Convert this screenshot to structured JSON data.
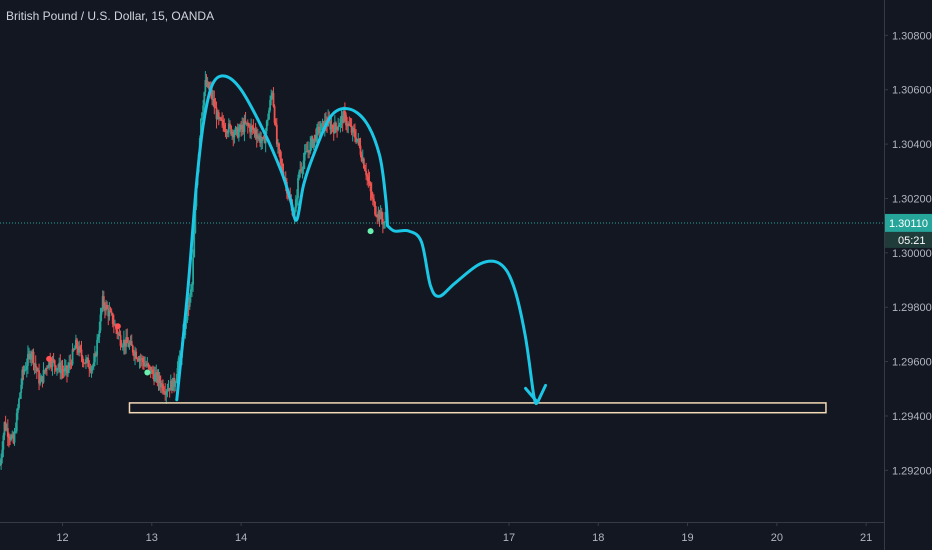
{
  "title": "British Pound / U.S. Dollar, 15, OANDA",
  "colors": {
    "background": "#131722",
    "grid": "#1e2230",
    "axis": "#363a45",
    "text": "#b2b5be",
    "up": "#26a69a",
    "down": "#ef5350",
    "price_line": "#26a69a",
    "drawing": "#1cc6e5",
    "zone": "#f3d9b5"
  },
  "chart_data": {
    "type": "candlestick",
    "symbol": "GBPUSD",
    "timeframe": "15",
    "x_ticks": [
      "12",
      "13",
      "14",
      "17",
      "18",
      "19",
      "20",
      "21"
    ],
    "xlim": [
      11.3,
      21.2
    ],
    "y_ticks": [
      "1.29200",
      "1.29400",
      "1.29600",
      "1.29800",
      "1.30000",
      "1.30200",
      "1.30400",
      "1.30600",
      "1.30800"
    ],
    "ylim": [
      1.2901,
      1.3093
    ],
    "last_price": "1.30110",
    "countdown": "05:21",
    "grid": false,
    "price_outline": [
      [
        11.3,
        1.2922
      ],
      [
        11.35,
        1.2937
      ],
      [
        11.45,
        1.293
      ],
      [
        11.55,
        1.2955
      ],
      [
        11.65,
        1.2964
      ],
      [
        11.75,
        1.2952
      ],
      [
        11.85,
        1.2961
      ],
      [
        11.95,
        1.2958
      ],
      [
        12.05,
        1.2956
      ],
      [
        12.15,
        1.2966
      ],
      [
        12.25,
        1.296
      ],
      [
        12.35,
        1.2958
      ],
      [
        12.45,
        1.2982
      ],
      [
        12.55,
        1.2976
      ],
      [
        12.65,
        1.2968
      ],
      [
        12.75,
        1.2966
      ],
      [
        12.85,
        1.2962
      ],
      [
        12.95,
        1.2958
      ],
      [
        13.05,
        1.2954
      ],
      [
        13.15,
        1.295
      ],
      [
        13.25,
        1.2952
      ],
      [
        13.32,
        1.2962
      ],
      [
        13.38,
        1.2975
      ],
      [
        13.45,
        1.2988
      ],
      [
        13.5,
        1.3025
      ],
      [
        13.55,
        1.305
      ],
      [
        13.6,
        1.3062
      ],
      [
        13.65,
        1.306
      ],
      [
        13.75,
        1.3048
      ],
      [
        13.85,
        1.3046
      ],
      [
        13.95,
        1.3044
      ],
      [
        14.05,
        1.3047
      ],
      [
        14.15,
        1.3045
      ],
      [
        14.25,
        1.304
      ],
      [
        14.3,
        1.305
      ],
      [
        14.35,
        1.306
      ],
      [
        14.4,
        1.304
      ],
      [
        14.45,
        1.3032
      ],
      [
        14.5,
        1.3026
      ],
      [
        14.55,
        1.3018
      ],
      [
        14.6,
        1.3014
      ],
      [
        14.65,
        1.303
      ],
      [
        14.75,
        1.3038
      ],
      [
        14.85,
        1.3044
      ],
      [
        14.95,
        1.3048
      ],
      [
        15.05,
        1.3046
      ],
      [
        15.15,
        1.305
      ],
      [
        15.25,
        1.3044
      ],
      [
        15.3,
        1.3042
      ],
      [
        15.35,
        1.3036
      ],
      [
        15.4,
        1.303
      ],
      [
        15.45,
        1.3022
      ],
      [
        15.5,
        1.3016
      ],
      [
        15.55,
        1.3014
      ],
      [
        15.62,
        1.301
      ]
    ],
    "markers": [
      {
        "x": 11.85,
        "y": 1.2961,
        "type": "sell"
      },
      {
        "x": 12.62,
        "y": 1.2973,
        "type": "sell"
      },
      {
        "x": 12.95,
        "y": 1.2956,
        "type": "buy"
      },
      {
        "x": 15.45,
        "y": 1.3008,
        "type": "buy"
      }
    ],
    "annotations": {
      "double_top_path": [
        [
          13.28,
          1.2946
        ],
        [
          13.4,
          1.2985
        ],
        [
          13.5,
          1.3025
        ],
        [
          13.58,
          1.3048
        ],
        [
          13.68,
          1.3062
        ],
        [
          13.82,
          1.3065
        ],
        [
          14.0,
          1.306
        ],
        [
          14.25,
          1.3045
        ],
        [
          14.45,
          1.303
        ],
        [
          14.55,
          1.302
        ],
        [
          14.62,
          1.3012
        ],
        [
          14.7,
          1.3025
        ],
        [
          14.8,
          1.3035
        ],
        [
          15.0,
          1.305
        ],
        [
          15.2,
          1.3053
        ],
        [
          15.4,
          1.3048
        ],
        [
          15.55,
          1.3036
        ],
        [
          15.62,
          1.302
        ],
        [
          15.64,
          1.301
        ]
      ],
      "projection_path": [
        [
          15.64,
          1.301
        ],
        [
          15.72,
          1.3008
        ],
        [
          15.88,
          1.3008
        ],
        [
          16.02,
          1.3004
        ],
        [
          16.12,
          1.2988
        ],
        [
          16.22,
          1.2984
        ],
        [
          16.4,
          1.2989
        ],
        [
          16.68,
          1.2996
        ],
        [
          16.9,
          1.2996
        ],
        [
          17.05,
          1.2988
        ],
        [
          17.18,
          1.297
        ],
        [
          17.28,
          1.2947
        ],
        [
          17.32,
          1.2945
        ]
      ],
      "arrow_tip": [
        17.32,
        1.2945
      ],
      "target_zone": {
        "x_start": 12.75,
        "x_end": 20.55,
        "y_top": 1.29448,
        "y_bottom": 1.29412
      }
    }
  }
}
